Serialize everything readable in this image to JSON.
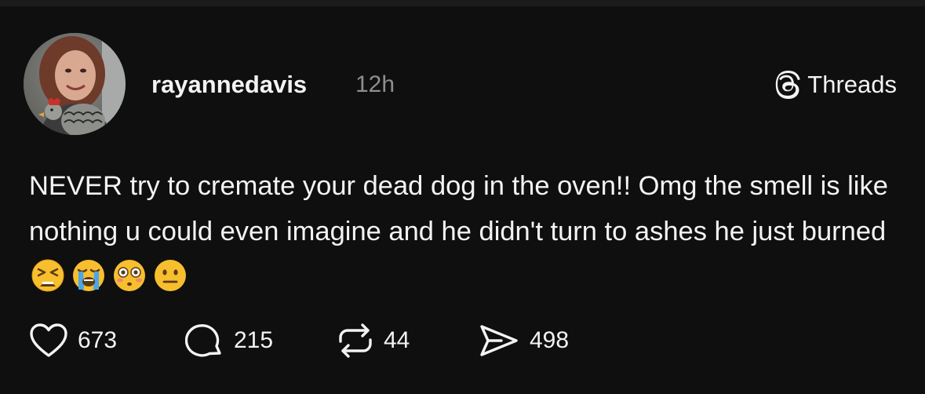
{
  "post": {
    "author": {
      "username": "rayannedavis",
      "avatar_alt": "avatar"
    },
    "timestamp": "12h",
    "brand": {
      "label": "Threads",
      "icon": "threads-logo-icon"
    },
    "text": "NEVER try to cremate your dead dog in the oven!! Omg the smell is like nothing u could even imagine and he didn't turn to ashes he just burned",
    "emojis": [
      "tired-face-emoji",
      "loudly-crying-face-emoji",
      "flushed-face-emoji",
      "neutral-face-emoji"
    ]
  },
  "actions": {
    "likes": {
      "icon": "heart-icon",
      "count": "673"
    },
    "replies": {
      "icon": "comment-icon",
      "count": "215"
    },
    "reposts": {
      "icon": "repost-icon",
      "count": "44"
    },
    "shares": {
      "icon": "send-icon",
      "count": "498"
    }
  },
  "colors": {
    "background": "#0f0f0f",
    "text": "#f3f3f3",
    "muted": "#8e8e8e",
    "emoji_yellow": "#f7bf2e"
  }
}
